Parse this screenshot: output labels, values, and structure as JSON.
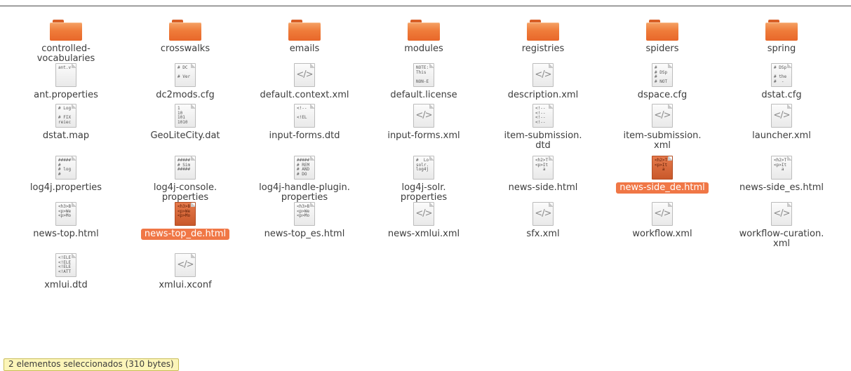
{
  "window": {
    "title": ""
  },
  "files": [
    {
      "name": "controlled-\nvocabularies",
      "kind": "folder",
      "icon": "folder-icon",
      "selected": false,
      "preview": ""
    },
    {
      "name": "crosswalks",
      "kind": "folder",
      "icon": "folder-icon",
      "selected": false,
      "preview": ""
    },
    {
      "name": "emails",
      "kind": "folder",
      "icon": "folder-icon",
      "selected": false,
      "preview": ""
    },
    {
      "name": "modules",
      "kind": "folder",
      "icon": "folder-icon",
      "selected": false,
      "preview": ""
    },
    {
      "name": "registries",
      "kind": "folder",
      "icon": "folder-icon",
      "selected": false,
      "preview": ""
    },
    {
      "name": "spiders",
      "kind": "folder",
      "icon": "folder-icon",
      "selected": false,
      "preview": ""
    },
    {
      "name": "spring",
      "kind": "folder",
      "icon": "folder-icon",
      "selected": false,
      "preview": ""
    },
    {
      "name": "ant.properties",
      "kind": "text",
      "icon": "text-file-icon",
      "selected": false,
      "preview": "ant.v"
    },
    {
      "name": "dc2mods.cfg",
      "kind": "text",
      "icon": "text-file-icon",
      "selected": false,
      "preview": "# DC\n\n# Ver"
    },
    {
      "name": "default.context.xml",
      "kind": "xml",
      "icon": "xml-file-icon",
      "selected": false,
      "preview": ""
    },
    {
      "name": "default.license",
      "kind": "text",
      "icon": "text-file-icon",
      "selected": false,
      "preview": "NOTE:\nThis\n\nNON-E"
    },
    {
      "name": "description.xml",
      "kind": "xml",
      "icon": "xml-file-icon",
      "selected": false,
      "preview": ""
    },
    {
      "name": "dspace.cfg",
      "kind": "text",
      "icon": "text-file-icon",
      "selected": false,
      "preview": "#\n# DSp\n#\n# NOT"
    },
    {
      "name": "dstat.cfg",
      "kind": "text",
      "icon": "text-file-icon",
      "selected": false,
      "preview": "# DSp\n\n# the\n#  -"
    },
    {
      "name": "dstat.map",
      "kind": "text",
      "icon": "text-file-icon",
      "selected": false,
      "preview": "# Log\n\n# FIX\nreiec"
    },
    {
      "name": "GeoLiteCity.dat",
      "kind": "binary",
      "icon": "binary-file-icon",
      "selected": false,
      "preview": "1\n10\n101\n1010"
    },
    {
      "name": "input-forms.dtd",
      "kind": "text",
      "icon": "text-file-icon",
      "selected": false,
      "preview": "<!--\n\n<!EL"
    },
    {
      "name": "input-forms.xml",
      "kind": "xml",
      "icon": "xml-file-icon",
      "selected": false,
      "preview": ""
    },
    {
      "name": "item-submission.\ndtd",
      "kind": "text",
      "icon": "text-file-icon",
      "selected": false,
      "preview": "<!--\n<!--\n<!--\n<!--"
    },
    {
      "name": "item-submission.\nxml",
      "kind": "xml",
      "icon": "xml-file-icon",
      "selected": false,
      "preview": ""
    },
    {
      "name": "launcher.xml",
      "kind": "xml",
      "icon": "xml-file-icon",
      "selected": false,
      "preview": ""
    },
    {
      "name": "log4j.properties",
      "kind": "text",
      "icon": "text-file-icon",
      "selected": false,
      "preview": "#####\n#\n# log\n#"
    },
    {
      "name": "log4j-console.\nproperties",
      "kind": "text",
      "icon": "text-file-icon",
      "selected": false,
      "preview": "#####\n# Sim\n#####"
    },
    {
      "name": "log4j-handle-plugin.\nproperties",
      "kind": "text",
      "icon": "text-file-icon",
      "selected": false,
      "preview": "#####\n# REM\n# AND\n# DO"
    },
    {
      "name": "log4j-solr.\nproperties",
      "kind": "text",
      "icon": "text-file-icon",
      "selected": false,
      "preview": "#  Lo\nsolr.\nlog4j"
    },
    {
      "name": "news-side.html",
      "kind": "html",
      "icon": "html-file-icon",
      "selected": false,
      "preview": "<h2>T\n<p>It\n   a"
    },
    {
      "name": "news-side_de.html",
      "kind": "html",
      "icon": "html-file-icon",
      "selected": true,
      "preview": "<h2>T\n<p>It\n   a"
    },
    {
      "name": "news-side_es.html",
      "kind": "html",
      "icon": "html-file-icon",
      "selected": false,
      "preview": "<h2>T\n<p>It\n   a"
    },
    {
      "name": "news-top.html",
      "kind": "html",
      "icon": "html-file-icon",
      "selected": false,
      "preview": "<h3>B\n<p>We\n<p>Mo"
    },
    {
      "name": "news-top_de.html",
      "kind": "html",
      "icon": "html-file-icon",
      "selected": true,
      "preview": "<h3>B\n<p>We\n<p>Mo"
    },
    {
      "name": "news-top_es.html",
      "kind": "html",
      "icon": "html-file-icon",
      "selected": false,
      "preview": "<h3>B\n<p>We\n<p>Mo"
    },
    {
      "name": "news-xmlui.xml",
      "kind": "xml",
      "icon": "xml-file-icon",
      "selected": false,
      "preview": ""
    },
    {
      "name": "sfx.xml",
      "kind": "xml",
      "icon": "xml-file-icon",
      "selected": false,
      "preview": ""
    },
    {
      "name": "workflow.xml",
      "kind": "xml",
      "icon": "xml-file-icon",
      "selected": false,
      "preview": ""
    },
    {
      "name": "workflow-curation.\nxml",
      "kind": "xml",
      "icon": "xml-file-icon",
      "selected": false,
      "preview": ""
    },
    {
      "name": "xmlui.dtd",
      "kind": "text",
      "icon": "text-file-icon",
      "selected": false,
      "preview": "<!ELE\n<!ELE\n<!ELE\n<!ATT"
    },
    {
      "name": "xmlui.xconf",
      "kind": "xml",
      "icon": "xml-file-icon",
      "selected": false,
      "preview": ""
    }
  ],
  "xml_glyph": "</>",
  "status": {
    "text": "2 elementos seleccionados  (310 bytes)"
  },
  "colors": {
    "selection": "#f07746",
    "folder": "#ef7c3a",
    "status_bg": "#fcf5b9"
  }
}
